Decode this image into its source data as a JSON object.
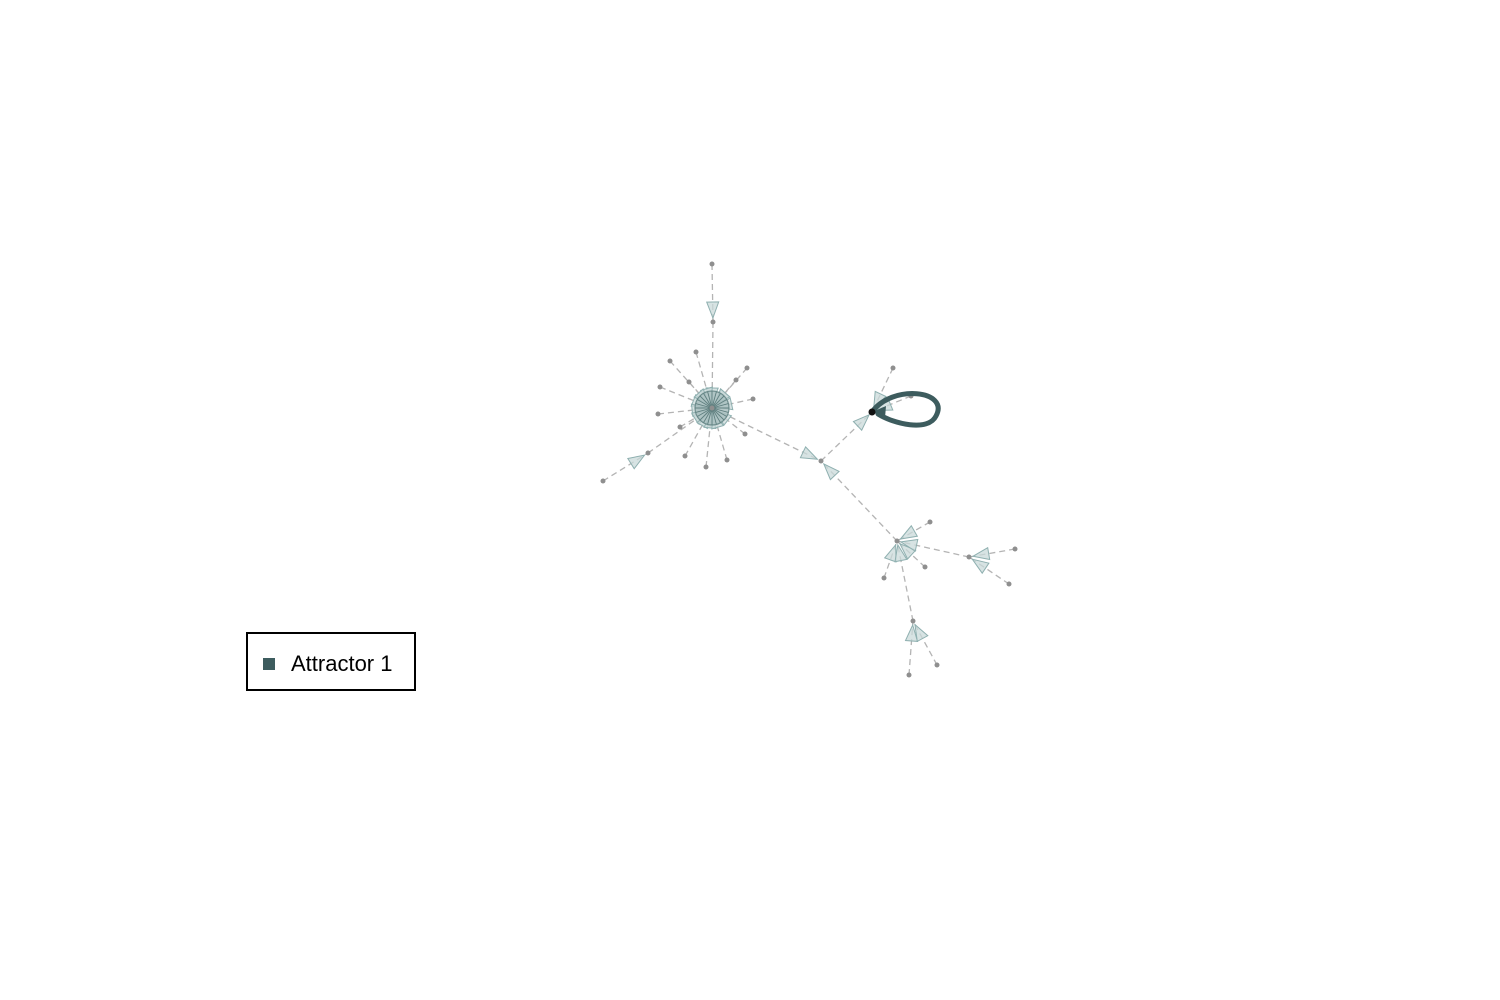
{
  "graph": {
    "attractor_color": "#3d5c5e",
    "edge_color": "#b4b4b4",
    "node_color": "#8f8f8f",
    "arrow_fill": "#c9dada",
    "arrow_stroke": "#8fb0b0"
  },
  "legend": {
    "entries": [
      {
        "label": "Attractor 1",
        "color": "#3d5c5e"
      }
    ]
  }
}
